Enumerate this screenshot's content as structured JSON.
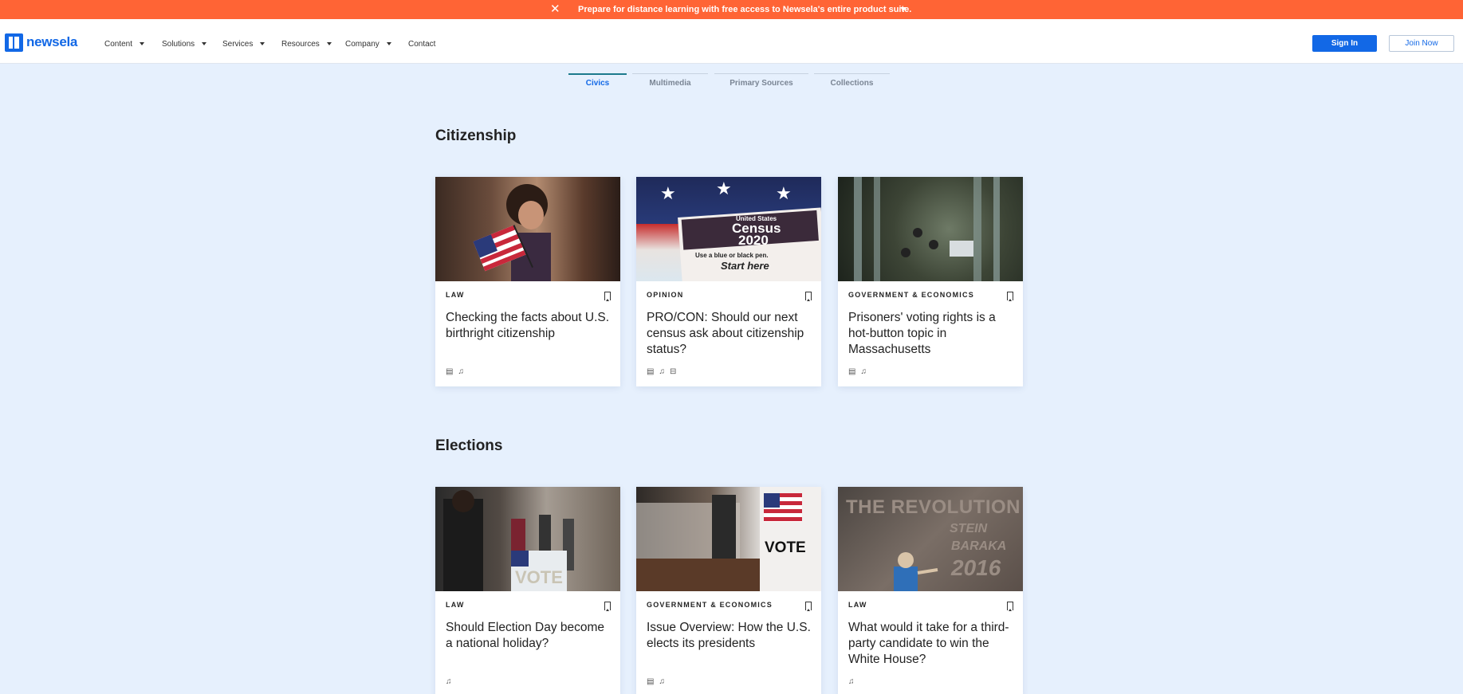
{
  "banner": {
    "close_glyph": "✕",
    "message": "Prepare for distance learning with free access to Newsela's entire product suite.",
    "background": "#ff6435"
  },
  "nav": {
    "logo_text": "newsela",
    "items": [
      {
        "label": "Content",
        "dropdown": true
      },
      {
        "label": "Solutions",
        "dropdown": true
      },
      {
        "label": "Services",
        "dropdown": true
      },
      {
        "label": "Resources",
        "dropdown": true
      },
      {
        "label": "Company",
        "dropdown": true
      },
      {
        "label": "Contact",
        "dropdown": false
      }
    ],
    "sign_in": "Sign In",
    "join_now": "Join Now",
    "accent": "#1268e6"
  },
  "tabs": [
    {
      "label": "Civics",
      "active": true
    },
    {
      "label": "Multimedia",
      "active": false
    },
    {
      "label": "Primary Sources",
      "active": false
    },
    {
      "label": "Collections",
      "active": false
    }
  ],
  "sections": [
    {
      "title": "Citizenship",
      "cards": [
        {
          "category": "LAW",
          "title": "Checking the facts about U.S. birthright citizenship",
          "icons": [
            "text-icon",
            "audio-icon"
          ]
        },
        {
          "category": "OPINION",
          "title": "PRO/CON: Should our next census ask about citizenship status?",
          "icons": [
            "text-icon",
            "audio-icon",
            "discussion-icon"
          ],
          "image_text": {
            "line1": "United States",
            "line2": "Census",
            "line3": "2020",
            "line4": "Use a blue or black pen.",
            "line5": "Start here"
          }
        },
        {
          "category": "GOVERNMENT & ECONOMICS",
          "title": "Prisoners' voting rights is a hot-button topic in Massachusetts",
          "icons": [
            "text-icon",
            "audio-icon"
          ]
        }
      ]
    },
    {
      "title": "Elections",
      "cards": [
        {
          "category": "LAW",
          "title": "Should Election Day become a national holiday?",
          "icons": [
            "audio-icon"
          ],
          "image_text": {
            "sign": "VOTE"
          }
        },
        {
          "category": "GOVERNMENT & ECONOMICS",
          "title": "Issue Overview: How the U.S. elects its presidents",
          "icons": [
            "text-icon",
            "audio-icon"
          ],
          "image_text": {
            "sign": "VOTE"
          }
        },
        {
          "category": "LAW",
          "title": "What would it take for a third-party candidate to win the White House?",
          "icons": [
            "audio-icon"
          ],
          "image_text": {
            "line1": "THE REVOLUTION",
            "line2": "STEIN",
            "line3": "BARAKA",
            "line4": "2016"
          }
        }
      ]
    }
  ]
}
